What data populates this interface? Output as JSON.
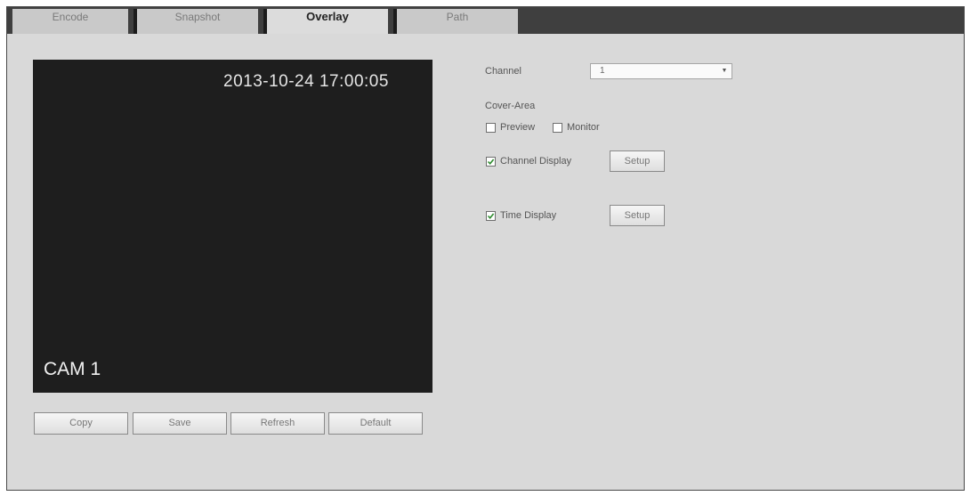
{
  "tabs": [
    {
      "label": "Encode",
      "active": false
    },
    {
      "label": "Snapshot",
      "active": false
    },
    {
      "label": "Overlay",
      "active": true
    },
    {
      "label": "Path",
      "active": false
    }
  ],
  "preview": {
    "timestamp": "2013-10-24 17:00:05",
    "channel_name": "CAM 1"
  },
  "buttons": {
    "copy": "Copy",
    "save": "Save",
    "refresh": "Refresh",
    "default": "Default"
  },
  "settings": {
    "channel_label": "Channel",
    "channel_value": "1",
    "cover_area_label": "Cover-Area",
    "preview_label": "Preview",
    "preview_checked": false,
    "monitor_label": "Monitor",
    "monitor_checked": false,
    "channel_display_label": "Channel Display",
    "channel_display_checked": true,
    "time_display_label": "Time Display",
    "time_display_checked": true,
    "setup_label": "Setup"
  },
  "colors": {
    "tab_bar": "#3f3f3f",
    "panel_bg": "#d9d9d9",
    "preview_bg": "#1e1e1e",
    "checkmark": "#2e8b2e"
  }
}
